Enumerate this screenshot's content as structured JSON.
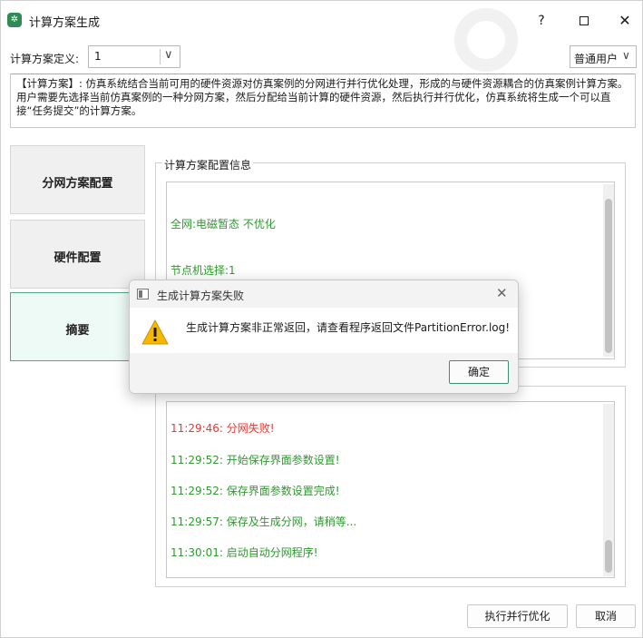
{
  "window": {
    "title": "计算方案生成",
    "help_glyph": "?",
    "close_glyph": "✕"
  },
  "definition": {
    "label": "计算方案定义:",
    "value": "1",
    "chevron": "∨"
  },
  "user_mode": {
    "value": "普通用户",
    "chevron": "∨"
  },
  "description": "【计算方案】: 仿真系统结合当前可用的硬件资源对仿真案例的分网进行并行优化处理，形成的与硬件资源耦合的仿真案例计算方案。用户需要先选择当前仿真案例的一种分网方案，然后分配给当前计算的硬件资源，然后执行并行优化，仿真系统将生成一个可以直接“任务提交”的计算方案。",
  "sidebar": {
    "items": [
      {
        "label": "分网方案配置"
      },
      {
        "label": "硬件配置"
      },
      {
        "label": "摘要"
      }
    ]
  },
  "config_info": {
    "title": "计算方案配置信息",
    "lines": [
      "全网:电磁暂态 不优化",
      "节点机选择:1"
    ]
  },
  "log": {
    "lines": [
      {
        "text": "11:29:46: 分网失败!",
        "color": "#e53935"
      },
      {
        "text": "11:29:52: 开始保存界面参数设置!",
        "color": "#2e9a2e"
      },
      {
        "text": "11:29:52: 保存界面参数设置完成!",
        "color": "#2e9a2e"
      },
      {
        "text": "11:29:57: 保存及生成分网，请稍等...",
        "color": "#2e9a2e"
      },
      {
        "text": "11:30:01: 启动自动分网程序!",
        "color": "#2e9a2e"
      }
    ]
  },
  "buttons": {
    "run": "执行并行优化",
    "cancel": "取消"
  },
  "dialog": {
    "title": "生成计算方案失败",
    "message": "生成计算方案非正常返回，请查看程序返回文件PartitionError.log!",
    "ok": "确定",
    "close_glyph": "✕"
  },
  "colors": {
    "accent": "#3c8f75",
    "success_text": "#2e9a2e",
    "error_text": "#e53935",
    "warning_icon": "#f5b800"
  },
  "icons": {
    "app": "app-logo-icon",
    "warning": "warning-triangle-icon",
    "dialog": "window-icon"
  }
}
